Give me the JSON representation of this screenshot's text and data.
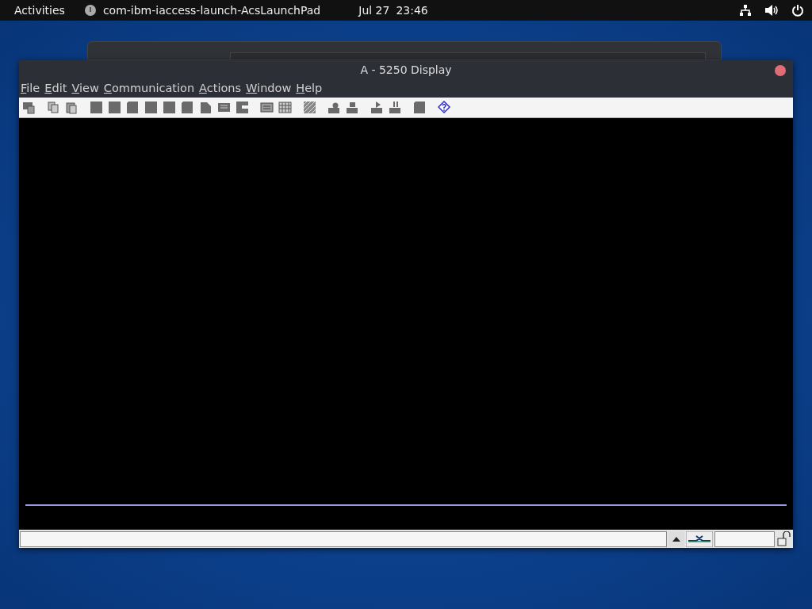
{
  "top_bar": {
    "activities": "Activities",
    "app_name": "com-ibm-iaccess-launch-AcsLaunchPad",
    "date": "Jul 27",
    "time": "23:46"
  },
  "window": {
    "title": "A - 5250 Display"
  },
  "menu": [
    "File",
    "Edit",
    "View",
    "Communication",
    "Actions",
    "Window",
    "Help"
  ]
}
